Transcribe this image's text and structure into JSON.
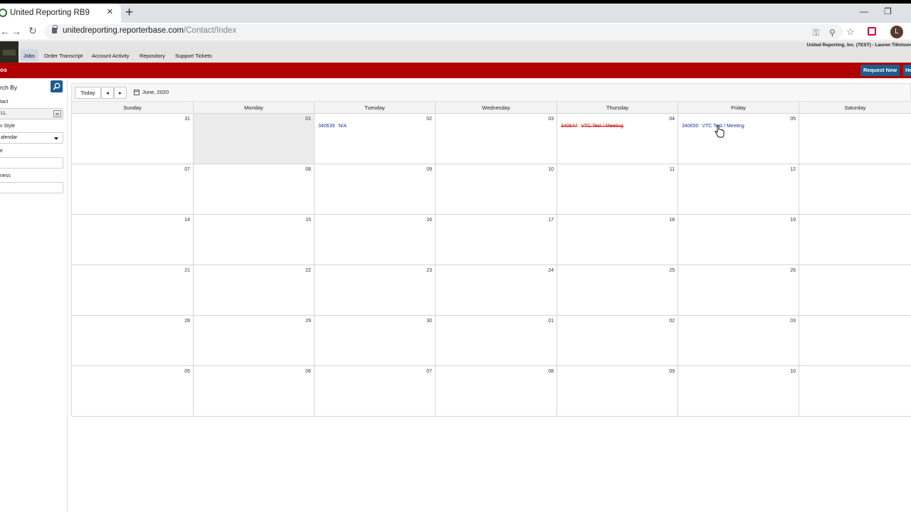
{
  "browser": {
    "tab_title": "United Reporting RB9",
    "url_host": "unitedreporting.reporterbase.com",
    "url_path": "/Contact/Index",
    "avatar_initial": "L"
  },
  "nav": {
    "items": [
      "Jobs",
      "Order Transcript",
      "Account Activity",
      "Repository",
      "Support Tickets"
    ],
    "active": "Jobs",
    "user_info": "United Reporting, Inc. (TEST) - Lauren Tillotson"
  },
  "header": {
    "section_label": "os",
    "request_button": "Request New",
    "help_button": "He"
  },
  "sidebar": {
    "search_title": "rch By",
    "contact_label": "tact",
    "contact_value": "LL",
    "view_style_label": "v Style",
    "view_style_value": "alendar",
    "field3_label": "e",
    "field4_label": "ness"
  },
  "toolbar": {
    "today": "Today",
    "prev": "◂",
    "next": "▸",
    "month": "June, 2020"
  },
  "calendar": {
    "days": [
      "Sunday",
      "Monday",
      "Tuesday",
      "Wednesday",
      "Thursday",
      "Friday",
      "Saturday"
    ],
    "weeks": [
      [
        "31",
        "01",
        "02",
        "03",
        "04",
        "05",
        ""
      ],
      [
        "07",
        "08",
        "09",
        "10",
        "11",
        "12",
        ""
      ],
      [
        "14",
        "15",
        "16",
        "17",
        "18",
        "19",
        ""
      ],
      [
        "21",
        "22",
        "23",
        "24",
        "25",
        "26",
        ""
      ],
      [
        "28",
        "29",
        "30",
        "01",
        "02",
        "03",
        ""
      ],
      [
        "05",
        "06",
        "07",
        "08",
        "09",
        "10",
        ""
      ]
    ],
    "today_cell": {
      "week": 0,
      "day": 1
    },
    "events": [
      {
        "week": 0,
        "day": 2,
        "id": "340639",
        "title": "N/A",
        "status": "active"
      },
      {
        "week": 0,
        "day": 4,
        "id": "340647",
        "title": "VTC Test / Meeting",
        "status": "cancelled"
      },
      {
        "week": 0,
        "day": 5,
        "id": "340650",
        "title": "VTC Test / Meeting",
        "status": "active"
      }
    ]
  },
  "colors": {
    "red_bar": "#b00000",
    "blue_button": "#1d5d8f",
    "event_link": "#1f3a93",
    "event_cancelled": "#d10f0f"
  }
}
